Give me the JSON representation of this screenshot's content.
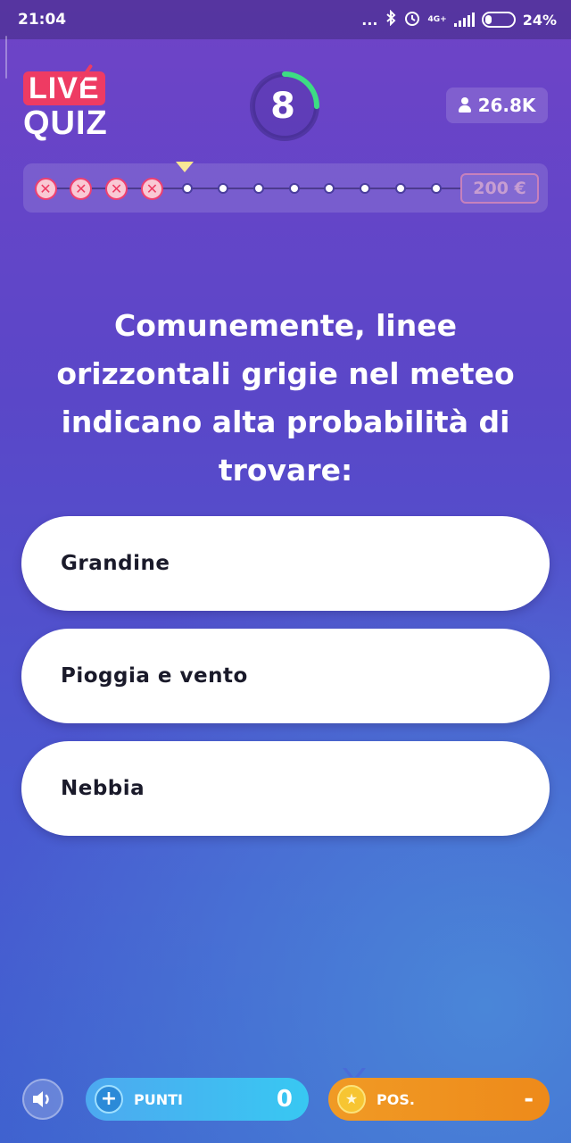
{
  "status_bar": {
    "time": "21:04",
    "dots": "...",
    "network": "4G+",
    "battery_percent": "24%",
    "battery_level": 0.24
  },
  "logo": {
    "line1": "LIVE",
    "line2": "QUIZ"
  },
  "timer": {
    "seconds": "8",
    "fraction_elapsed": 0.25,
    "ring_color": "#3ddc84"
  },
  "viewers": {
    "count": "26.8K",
    "icon": "user-icon"
  },
  "progress": {
    "wrong_count": 4,
    "total_steps": 12,
    "current_step": 5,
    "wrong_symbol": "✕",
    "prize": "200 €"
  },
  "question": {
    "text": "Comunemente, linee orizzontali grigie nel meteo indicano alta probabilità di trovare:"
  },
  "answers": [
    {
      "label": "Grandine"
    },
    {
      "label": "Pioggia e vento"
    },
    {
      "label": "Nebbia"
    }
  ],
  "bottom": {
    "sound_icon": "speaker-icon",
    "points_label": "PUNTI",
    "points_value": "0",
    "points_icon": "plus-icon",
    "pos_label": "POS.",
    "pos_value": "-",
    "pos_icon": "star-medal-icon"
  },
  "colors": {
    "accent_red": "#ee3b63",
    "points_blue": "#38c8f2",
    "pos_orange": "#f09a25"
  }
}
